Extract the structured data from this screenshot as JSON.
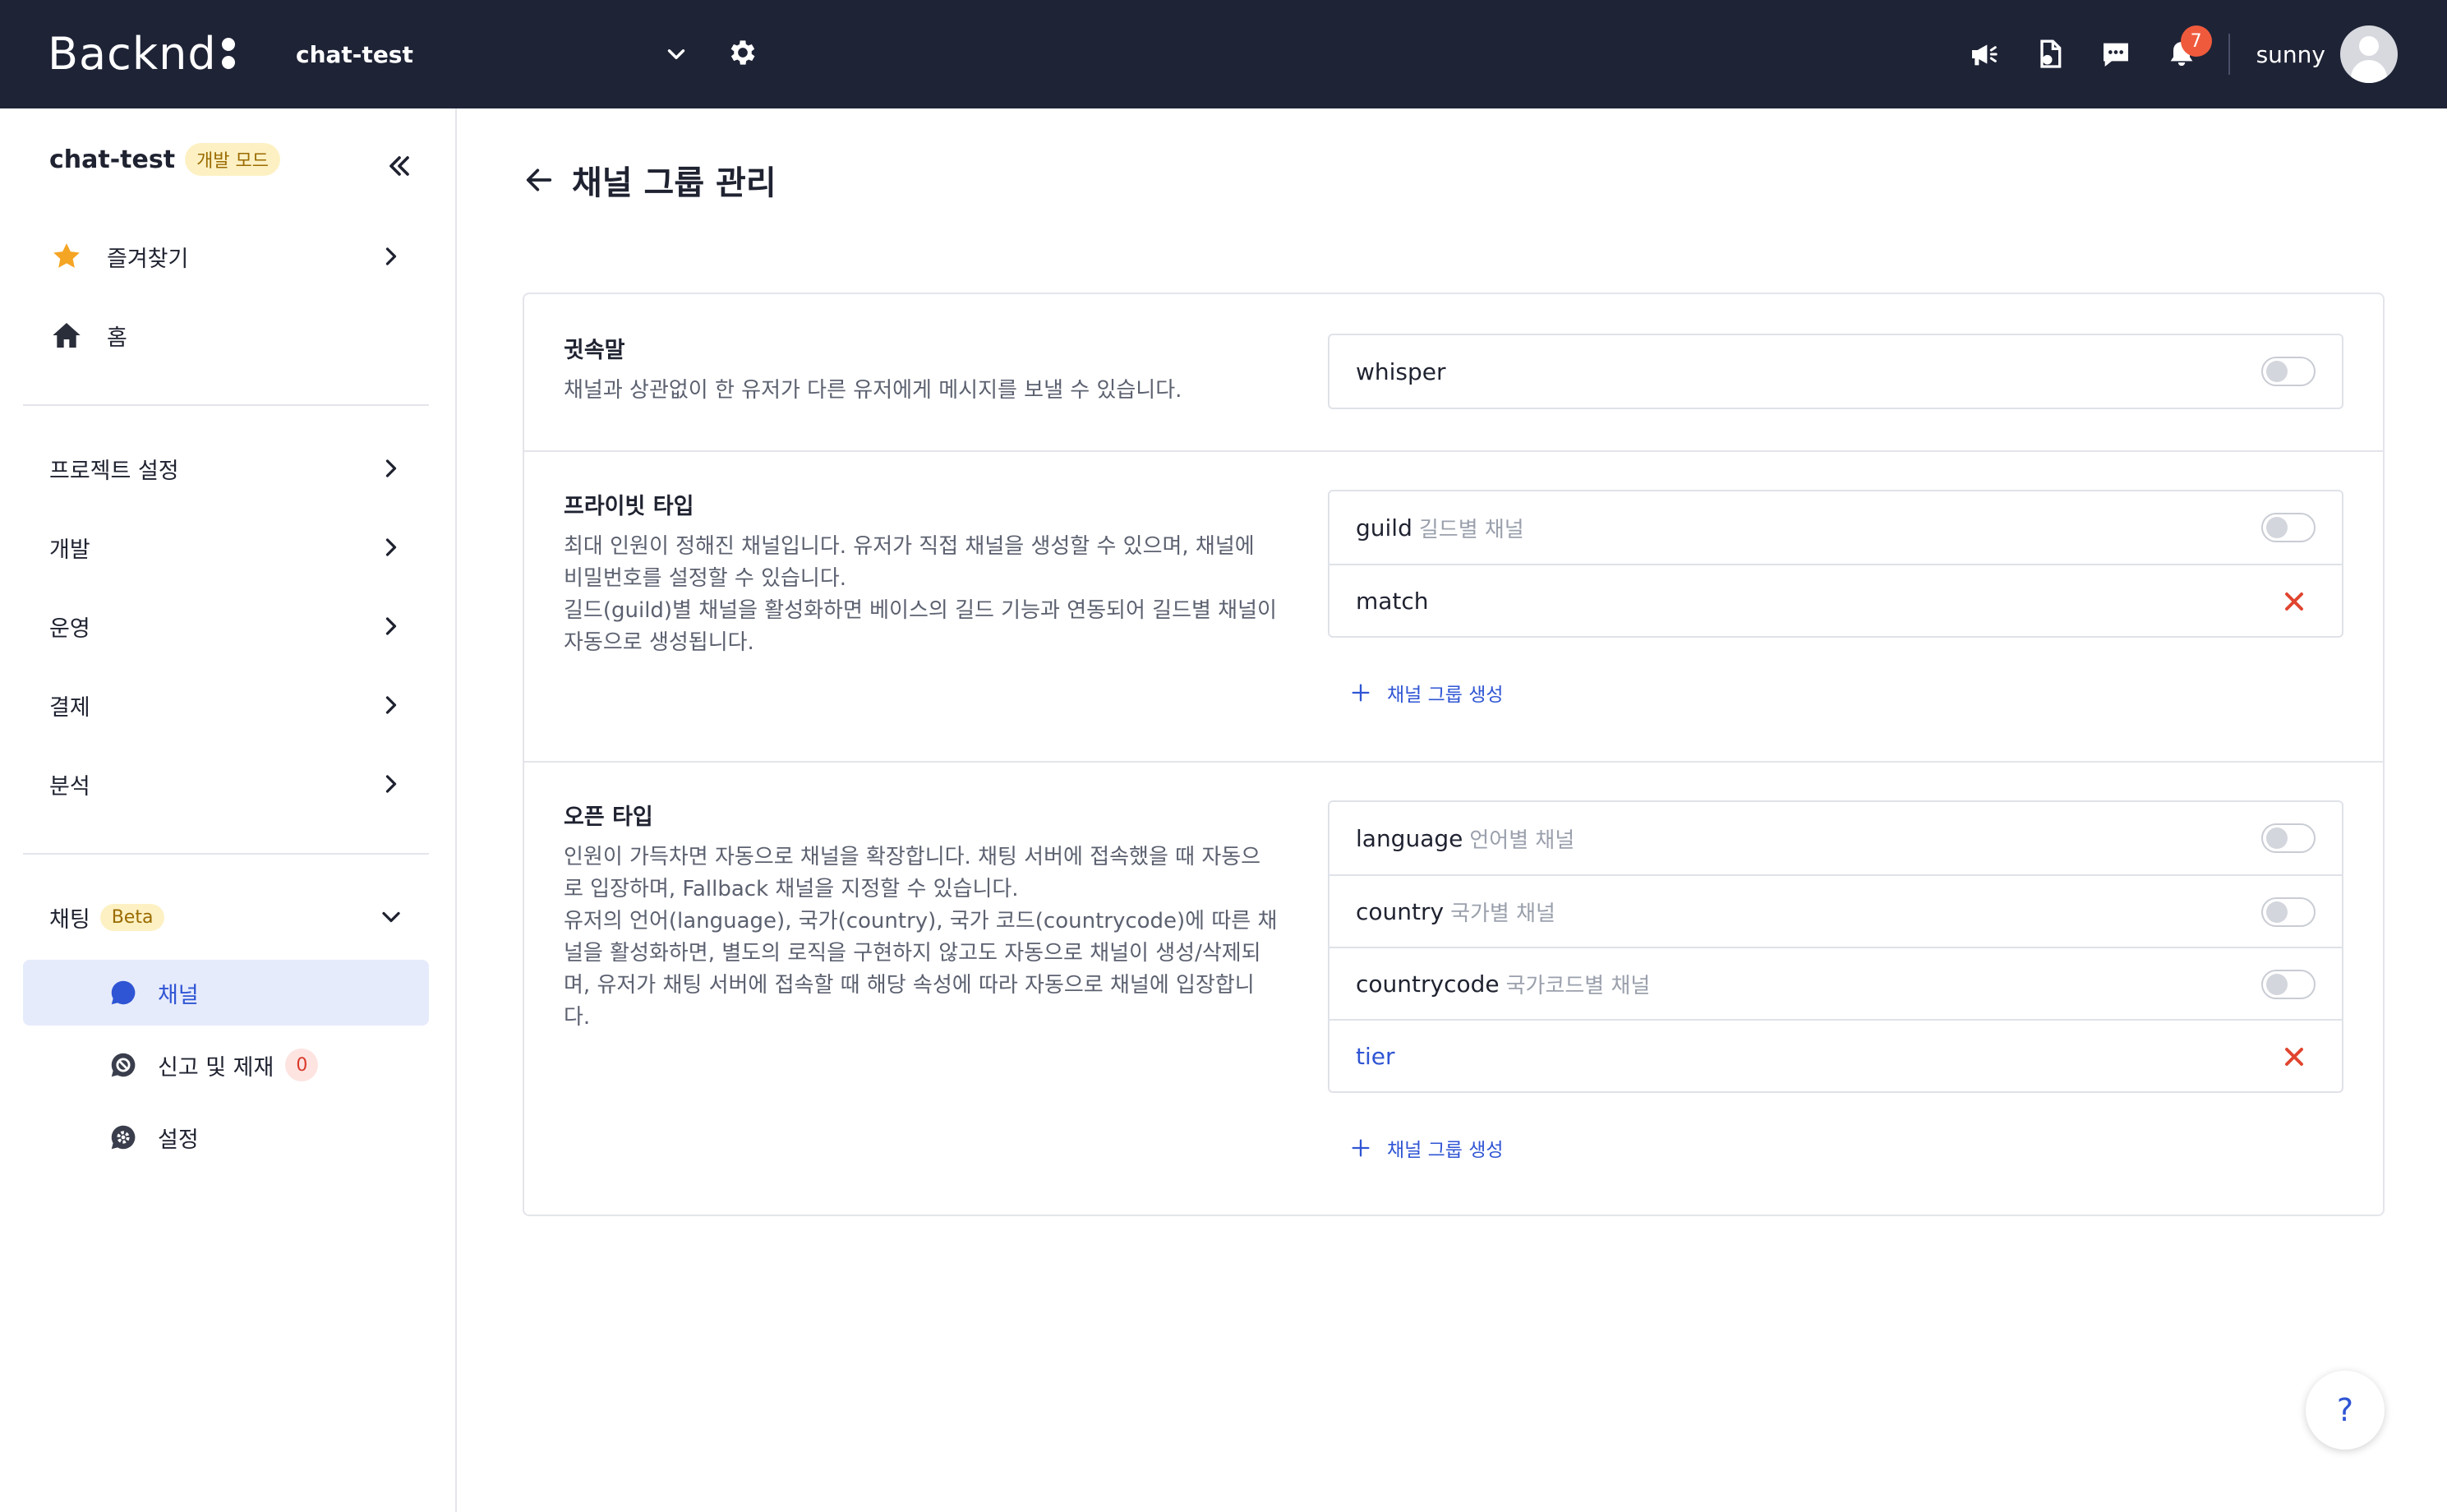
{
  "topbar": {
    "logo": "Backnd",
    "project": "chat-test",
    "notification_count": "7",
    "username": "sunny"
  },
  "sidebar": {
    "project_name": "chat-test",
    "mode_badge": "개발 모드",
    "items": [
      {
        "label": "즐겨찾기",
        "icon": "star-icon"
      },
      {
        "label": "홈",
        "icon": "home-icon"
      },
      {
        "label": "프로젝트 설정"
      },
      {
        "label": "개발"
      },
      {
        "label": "운영"
      },
      {
        "label": "결제"
      },
      {
        "label": "분석"
      }
    ],
    "chat": {
      "label": "채팅",
      "badge": "Beta",
      "subitems": [
        {
          "label": "채널",
          "icon": "chat-bubble-icon",
          "active": true
        },
        {
          "label": "신고 및 제재",
          "icon": "block-chat-icon",
          "count": "0"
        },
        {
          "label": "설정",
          "icon": "chat-settings-icon"
        }
      ]
    }
  },
  "main": {
    "title": "채널 그룹 관리",
    "sections": [
      {
        "title": "귓속말",
        "desc": "채널과 상관없이 한 유저가 다른 유저에게 메시지를 보낼 수 있습니다.",
        "options": [
          {
            "name": "whisper",
            "hint": "",
            "control": "toggle",
            "on": false
          }
        ]
      },
      {
        "title": "프라이빗 타입",
        "desc": "최대 인원이 정해진 채널입니다. 유저가 직접 채널을 생성할 수 있으며, 채널에\n비밀번호를 설정할 수 있습니다.\n길드(guild)별 채널을 활성화하면 베이스의 길드 기능과 연동되어 길드별 채널이\n자동으로 생성됩니다.",
        "options": [
          {
            "name": "guild",
            "hint": "길드별 채널",
            "control": "toggle",
            "on": false
          },
          {
            "name": "match",
            "hint": "",
            "control": "delete"
          }
        ],
        "add_label": "채널 그룹 생성"
      },
      {
        "title": "오픈 타입",
        "desc": "인원이 가득차면 자동으로 채널을 확장합니다. 채팅 서버에 접속했을 때 자동으\n로 입장하며, Fallback 채널을 지정할 수 있습니다.\n유저의 언어(language), 국가(country), 국가 코드(countrycode)에 따른 채\n널을 활성화하면, 별도의 로직을 구현하지 않고도 자동으로 채널이 생성/삭제되\n며, 유저가 채팅 서버에 접속할 때 해당 속성에 따라 자동으로 채널에 입장합니\n다.",
        "options": [
          {
            "name": "language",
            "hint": "언어별 채널",
            "control": "toggle",
            "on": false
          },
          {
            "name": "country",
            "hint": "국가별 채널",
            "control": "toggle",
            "on": false
          },
          {
            "name": "countrycode",
            "hint": "국가코드별 채널",
            "control": "toggle",
            "on": false
          },
          {
            "name": "tier",
            "hint": "",
            "control": "delete"
          }
        ],
        "add_label": "채널 그룹 생성"
      }
    ]
  },
  "help": "?",
  "colors": {
    "topbar_bg": "#1e2336",
    "accent": "#2f55d4",
    "danger": "#e0452f",
    "badge": "#f05a3c"
  }
}
